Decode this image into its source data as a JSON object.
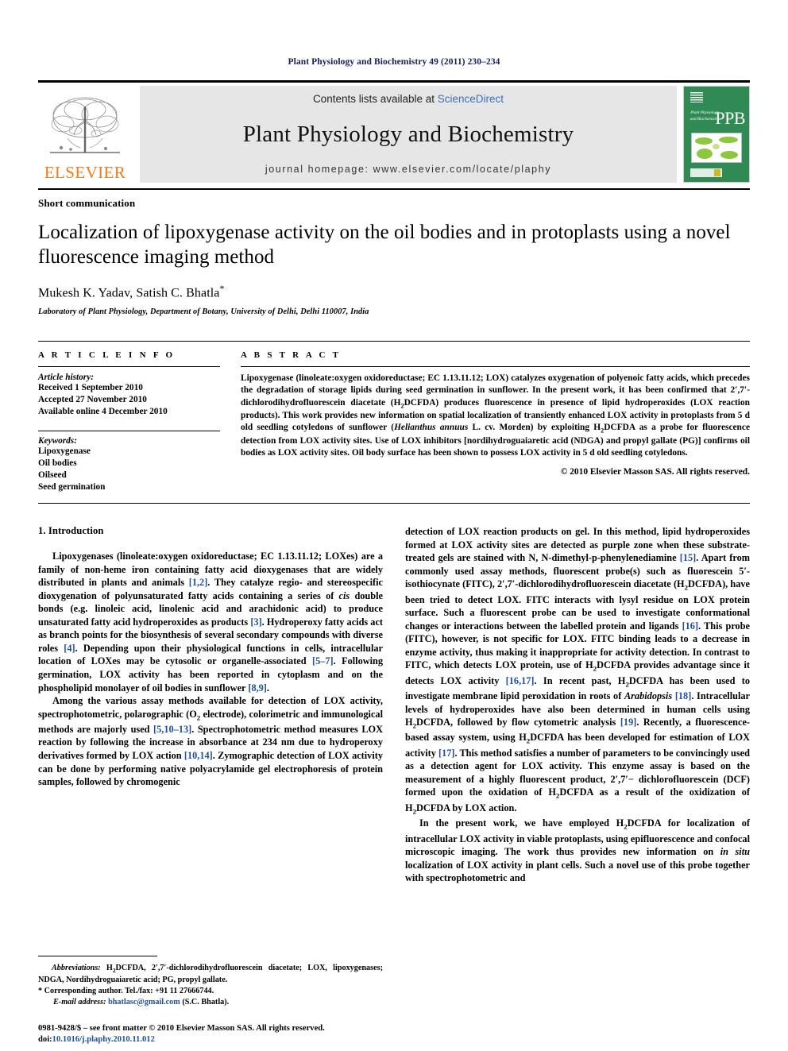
{
  "running_head": "Plant Physiology and Biochemistry 49 (2011) 230–234",
  "masthead": {
    "publisher_name": "ELSEVIER",
    "contents_prefix": "Contents lists available at ",
    "contents_link": "ScienceDirect",
    "journal_title": "Plant Physiology and Biochemistry",
    "homepage": "journal homepage: www.elsevier.com/locate/plaphy",
    "cover": {
      "journal_lines": "Plant Physiology and Biochemistry",
      "abbrev": "PPB"
    },
    "link_color": "#3b6fb6",
    "cover_color": "#2f8a54",
    "logo_color": "#ef7c1a"
  },
  "article": {
    "type": "Short communication",
    "title": "Localization of lipoxygenase activity on the oil bodies and in protoplasts using a novel fluorescence imaging method",
    "authors": "Mukesh K. Yadav, Satish C. Bhatla",
    "corresponding_marker": "*",
    "affiliation": "Laboratory of Plant Physiology, Department of Botany, University of Delhi, Delhi 110007, India"
  },
  "article_info": {
    "heading": "A R T I C L E    I N F O",
    "history_label": "Article history:",
    "history": [
      "Received 1 September 2010",
      "Accepted 27 November 2010",
      "Available online 4 December 2010"
    ],
    "keywords_label": "Keywords:",
    "keywords": [
      "Lipoxygenase",
      "Oil bodies",
      "Oilseed",
      "Seed germination"
    ]
  },
  "abstract": {
    "heading": "A B S T R A C T",
    "part1": "Lipoxygenase (linoleate:oxygen oxidoreductase; EC 1.13.11.12; LOX) catalyzes oxygenation of polyenoic fatty acids, which precedes the degradation of storage lipids during seed germination in sunflower. In the present work, it has been confirmed that 2′,7′-dichlorodihydrofluorescein diacetate (H",
    "sub1": "2",
    "part2": "DCFDA) produces fluorescence in presence of lipid hydroperoxides (LOX reaction products). This work provides new information on spatial localization of transiently enhanced LOX activity in protoplasts from 5 d old seedling cotyledons of sunflower (",
    "species": "Helianthus annuus",
    "part3": " L. cv. Morden) by exploiting H",
    "sub2": "2",
    "part4": "DCFDA as a probe for fluorescence detection from LOX activity sites. Use of LOX inhibitors [nordihydroguaiaretic acid (NDGA) and propyl gallate (PG)] confirms oil bodies as LOX activity sites. Oil body surface has been shown to possess LOX activity in 5 d old seedling cotyledons.",
    "copyright": "© 2010 Elsevier Masson SAS. All rights reserved."
  },
  "introduction": {
    "heading": "1.  Introduction",
    "left_p1_a": "Lipoxygenases (linoleate:oxygen oxidoreductase; EC 1.13.11.12; LOXes) are a family of non-heme iron containing fatty acid dioxygenases that are widely distributed in plants and animals ",
    "left_p1_r1": "[1,2]",
    "left_p1_b": ". They catalyze regio- and stereospecific dioxygenation of polyunsaturated fatty acids containing a series of ",
    "left_p1_cis": "cis",
    "left_p1_c": " double bonds (e.g. linoleic acid, linolenic acid and arachidonic acid) to produce unsaturated fatty acid hydroperoxides as products ",
    "left_p1_r2": "[3]",
    "left_p1_d": ". Hydroperoxy fatty acids act as branch points for the biosynthesis of several secondary compounds with diverse roles ",
    "left_p1_r3": "[4]",
    "left_p1_e": ". Depending upon their physiological functions in cells, intracellular location of LOXes may be cytosolic or organelle-associated ",
    "left_p1_r4": "[5–7]",
    "left_p1_f": ". Following germination, LOX activity has been reported in cytoplasm and on the phospholipid monolayer of oil bodies in sunflower ",
    "left_p1_r5": "[8,9]",
    "left_p1_g": ".",
    "left_p2_a": "Among the various assay methods available for detection of LOX activity, spectrophotometric, polarographic (O",
    "left_p2_sub": "2",
    "left_p2_b": " electrode), colorimetric and immunological methods are majorly used ",
    "left_p2_r1": "[5,10–13]",
    "left_p2_c": ". Spectrophotometric method measures LOX reaction by following the increase in absorbance at 234 nm due to hydroperoxy derivatives formed by LOX action ",
    "left_p2_r2": "[10,14]",
    "left_p2_d": ". Zymographic detection of LOX activity can be done by performing native polyacrylamide gel electrophoresis of protein samples, followed by chromogenic",
    "right_p1_a": "detection of LOX reaction products on gel. In this method, lipid hydroperoxides formed at LOX activity sites are detected as purple zone when these substrate-treated gels are stained with N, N-dimethyl-p-phenylenediamine ",
    "right_p1_r1": "[15]",
    "right_p1_b": ". Apart from commonly used assay methods, fluorescent probe(s) such as fluorescein 5′-isothiocynate (FITC), 2′,7′-dichlorodihydrofluorescein diacetate (H",
    "right_p1_sub1": "2",
    "right_p1_c": "DCFDA), have been tried to detect LOX. FITC interacts with lysyl residue on LOX protein surface. Such a fluorescent probe can be used to investigate conformational changes or interactions between the labelled protein and ligands ",
    "right_p1_r2": "[16]",
    "right_p1_d": ". This probe (FITC), however, is not specific for LOX. FITC binding leads to a decrease in enzyme activity, thus making it inappropriate for activity detection. In contrast to FITC, which detects LOX protein, use of H",
    "right_p1_sub2": "2",
    "right_p1_e": "DCFDA provides advantage since it detects LOX activity ",
    "right_p1_r3": "[16,17]",
    "right_p1_f": ". In recent past, H",
    "right_p1_sub3": "2",
    "right_p1_g": "DCFDA has been used to investigate membrane lipid peroxidation in roots of ",
    "right_p1_sp": "Arabidopsis",
    "right_p1_h": " ",
    "right_p1_r4": "[18]",
    "right_p1_i": ". Intracellular levels of hydroperoxides have also been determined in human cells using H",
    "right_p1_sub4": "2",
    "right_p1_j": "DCFDA, followed by flow cytometric analysis ",
    "right_p1_r5": "[19]",
    "right_p1_k": ". Recently, a fluorescence-based assay system, using H",
    "right_p1_sub5": "2",
    "right_p1_l": "DCFDA has been developed for estimation of LOX activity ",
    "right_p1_r6": "[17]",
    "right_p1_m": ". This method satisfies a number of parameters to be convincingly used as a detection agent for LOX activity. This enzyme assay is based on the measurement of a highly fluorescent product, 2′,7′− dichlorofluorescein (DCF) formed upon the oxidation of H",
    "right_p1_sub6": "2",
    "right_p1_n": "DCFDA as a result of the oxidization of H",
    "right_p1_sub7": "2",
    "right_p1_o": "DCFDA by LOX action.",
    "right_p2_a": "In the present work, we have employed H",
    "right_p2_sub": "2",
    "right_p2_b": "DCFDA for localization of intracellular LOX activity in viable protoplasts, using epifluorescence and confocal microscopic imaging. The work thus provides new information on ",
    "right_p2_insitu": "in situ",
    "right_p2_c": " localization of LOX activity in plant cells. Such a novel use of this probe together with spectrophotometric and"
  },
  "footnotes": {
    "abbrev_label": "Abbreviations:",
    "abbrev_a": " H",
    "abbrev_sub": "2",
    "abbrev_b": "DCFDA, 2′,7′-dichlorodihydrofluorescein diacetate; LOX, lipoxygenases; NDGA, Nordihydroguaiaretic acid; PG, propyl gallate.",
    "corresponding": "* Corresponding author. Tel./fax: +91 11 27666744.",
    "email_label": "E-mail address:",
    "email": "bhatlasc@gmail.com",
    "email_suffix": " (S.C. Bhatla)."
  },
  "imprint": {
    "line1": "0981-9428/$ – see front matter © 2010 Elsevier Masson SAS. All rights reserved.",
    "doi_label": "doi:",
    "doi": "10.1016/j.plaphy.2010.11.012"
  }
}
